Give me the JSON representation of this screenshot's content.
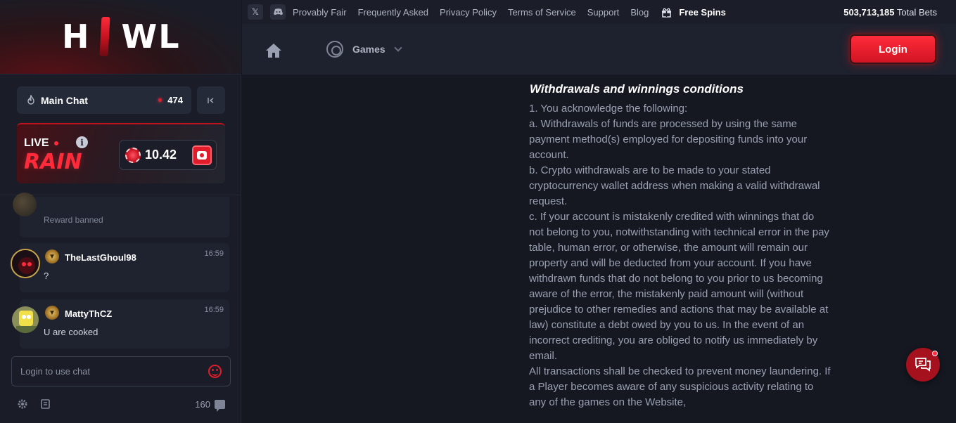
{
  "brand": {
    "logo_left": "H",
    "logo_right": "WL"
  },
  "chat": {
    "room_name": "Main Chat",
    "online_in_room": "474",
    "rain": {
      "live_label": "LIVE",
      "title": "RAIN",
      "amount": "10.42"
    },
    "messages": [
      {
        "user": "",
        "text": "Reward banned",
        "time": ""
      },
      {
        "user": "TheLastGhoul98",
        "text": "?",
        "time": "16:59"
      },
      {
        "user": "MattyThCZ",
        "text": "U are cooked",
        "time": "16:59"
      }
    ],
    "input_placeholder": "Login to use chat",
    "footer_count": "160"
  },
  "topbar": {
    "links": [
      "Provably Fair",
      "Frequently Asked",
      "Privacy Policy",
      "Terms of Service",
      "Support",
      "Blog"
    ],
    "free_spins": "Free Spins",
    "total_bets_value": "503,713,185",
    "total_bets_label": "Total Bets"
  },
  "header": {
    "games_label": "Games",
    "login_label": "Login"
  },
  "doc": {
    "title": "Withdrawals and winnings conditions",
    "paragraphs": [
      "1. You acknowledge the following:",
      "a. Withdrawals of funds are processed by using the same payment method(s) employed for depositing funds into your account.",
      "b. Crypto withdrawals are to be made to your stated cryptocurrency wallet address when making a valid withdrawal request.",
      "c. If your account is mistakenly credited with winnings that do not belong to you, notwithstanding with technical error in the pay table, human error, or otherwise, the amount will remain our property and will be deducted from your account. If you have withdrawn funds that do not belong to you prior to us becoming aware of the error, the mistakenly paid amount will (without prejudice to other remedies and actions that may be available at law) constitute a debt owed by you to us. In the event of an incorrect crediting, you are obliged to notify us immediately by email.",
      "All transactions shall be checked to prevent money laundering. If a Player becomes aware of any suspicious activity relating to any of the games on the Website,"
    ]
  },
  "colors": {
    "accent": "#e11d2b",
    "bg": "#151821",
    "sidebar": "#1a1d27",
    "text_muted": "#9aa0b2"
  }
}
